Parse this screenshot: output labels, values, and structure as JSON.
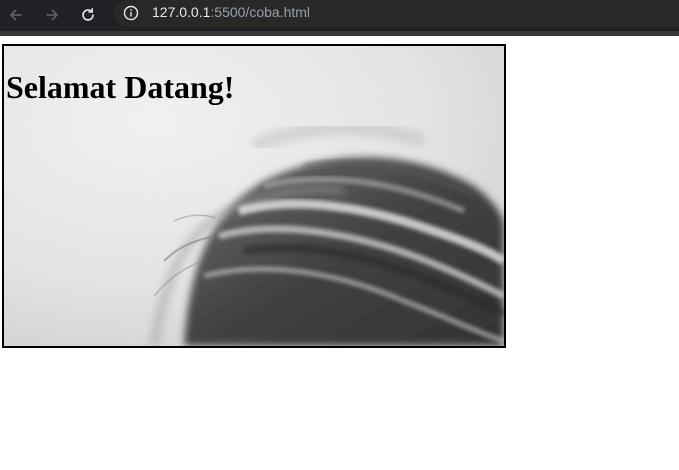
{
  "browser": {
    "url_host": "127.0.0.1",
    "url_path": ":5500/coba.html"
  },
  "page": {
    "heading": "Selamat Datang!"
  }
}
